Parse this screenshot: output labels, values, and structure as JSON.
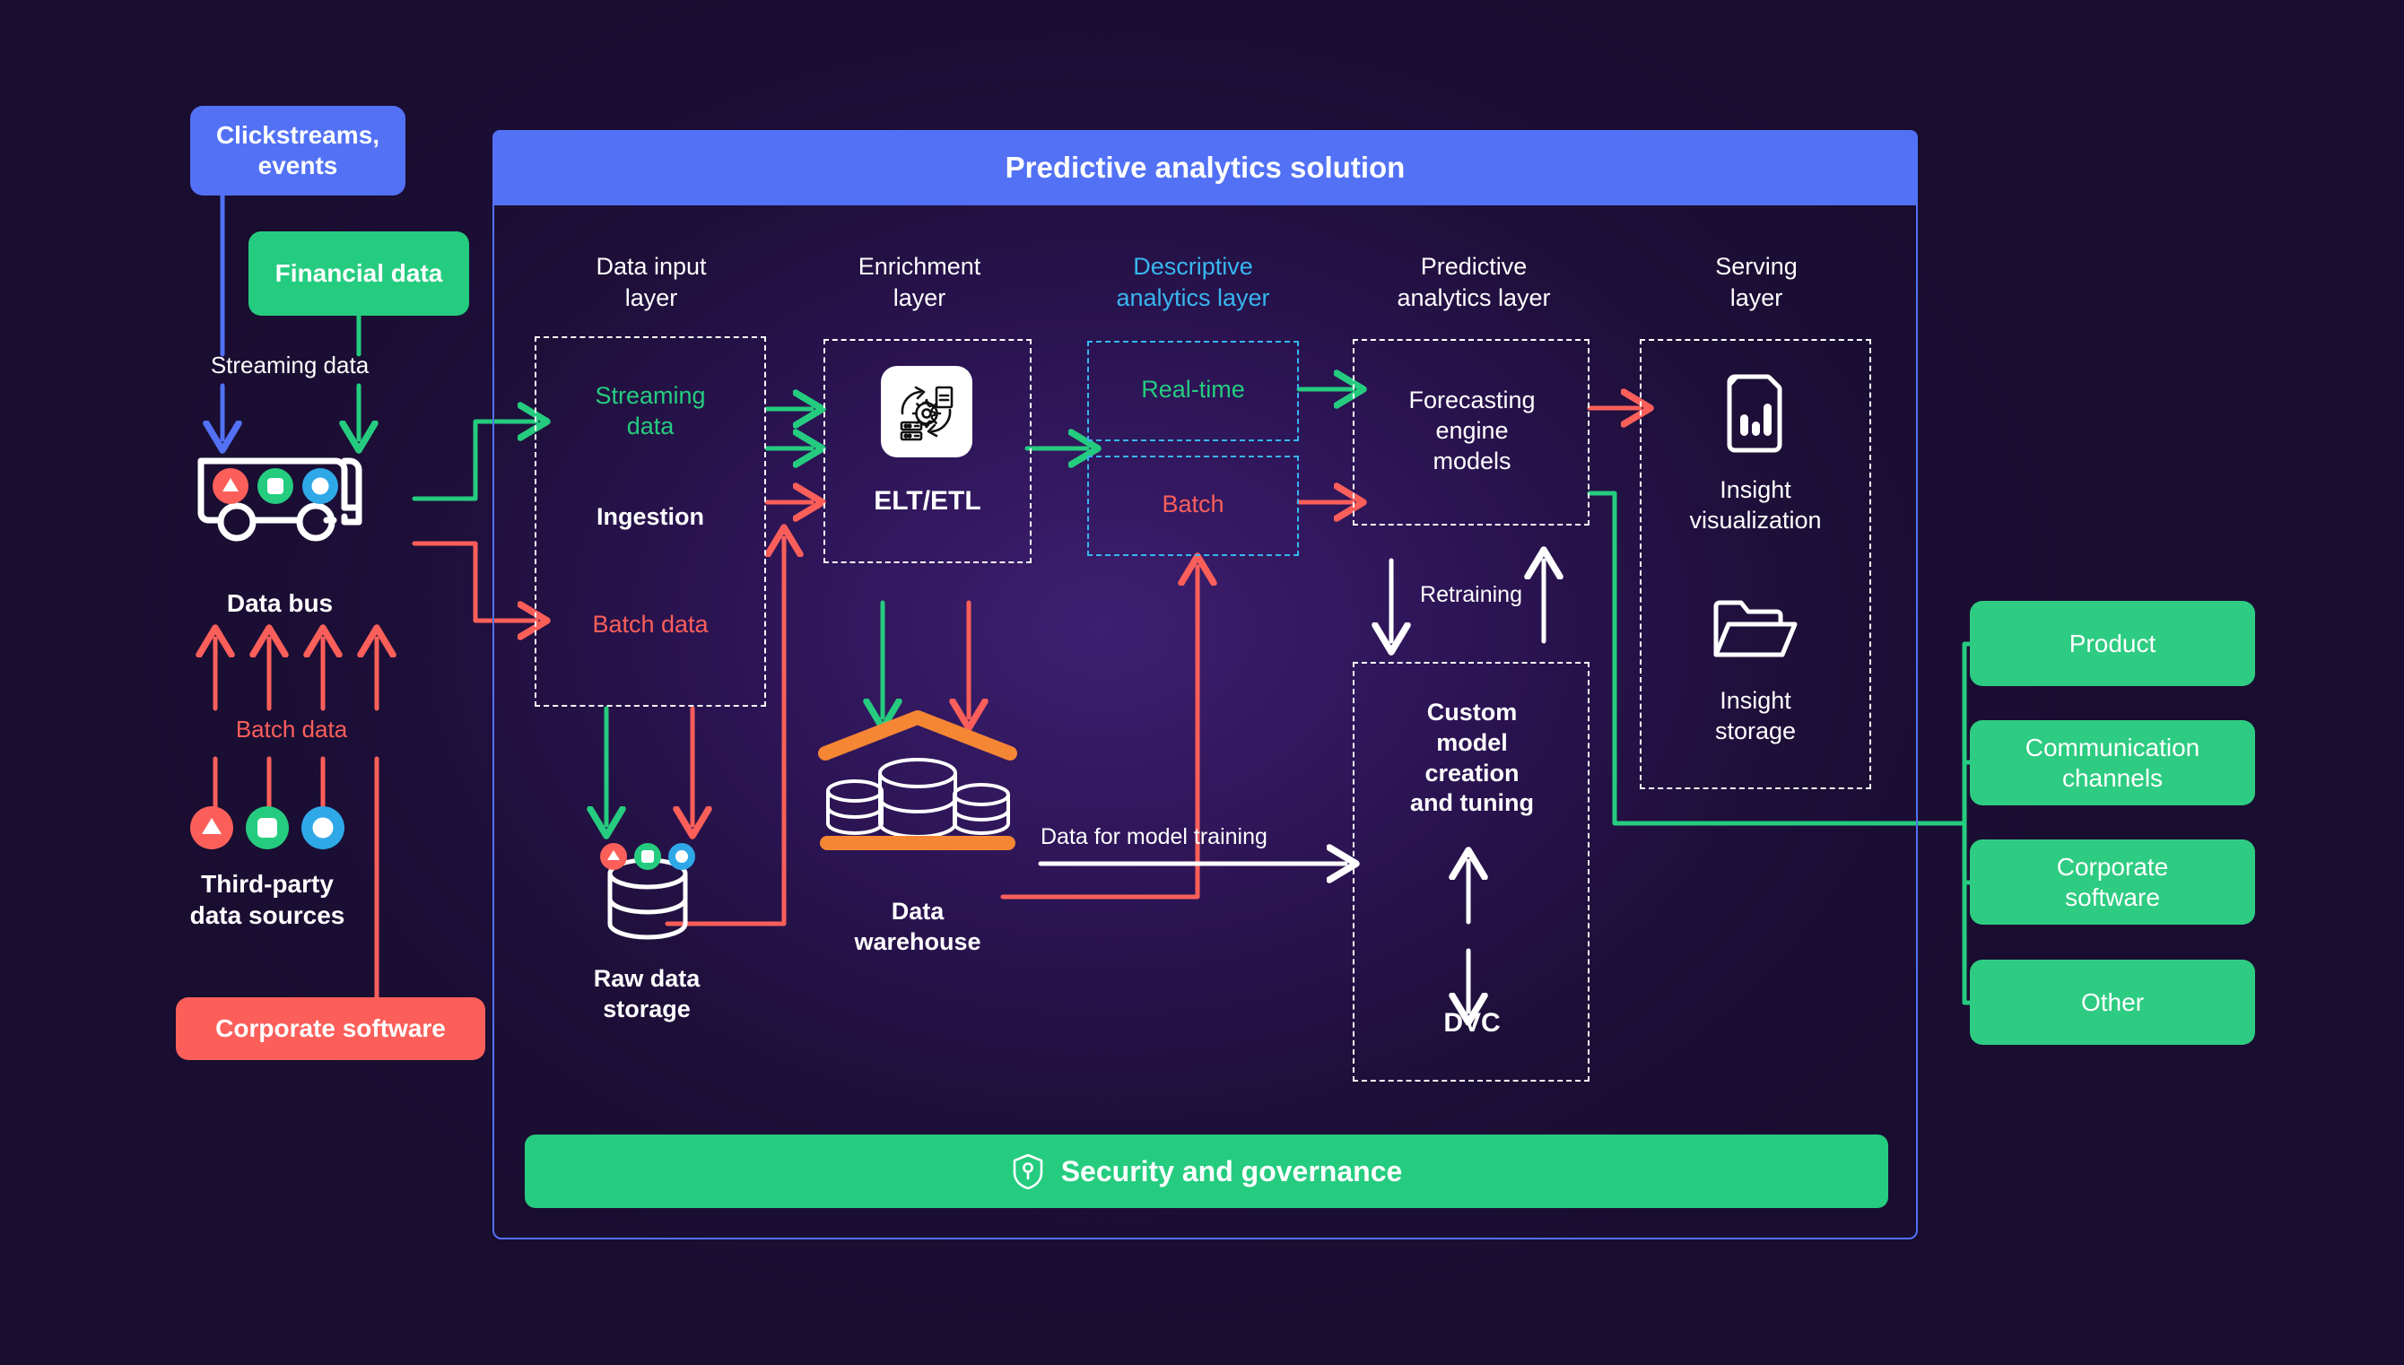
{
  "solution": {
    "title": "Predictive analytics solution"
  },
  "sources": {
    "clickstreams": "Clickstreams,\nevents",
    "financial": "Financial data",
    "streaming_label": "Streaming data",
    "data_bus": "Data bus",
    "batch_label": "Batch data",
    "third_party": "Third-party\ndata sources",
    "corporate_software": "Corporate software"
  },
  "layers": [
    {
      "key": "data_input",
      "title": "Data input\nlayer"
    },
    {
      "key": "enrichment",
      "title": "Enrichment\nlayer"
    },
    {
      "key": "descriptive",
      "title": "Descriptive\nanalytics layer"
    },
    {
      "key": "predictive",
      "title": "Predictive\nanalytics layer"
    },
    {
      "key": "serving",
      "title": "Serving\nlayer"
    }
  ],
  "data_input": {
    "streaming": "Streaming\ndata",
    "ingestion": "Ingestion",
    "batch": "Batch data"
  },
  "enrichment": {
    "label": "ELT/ETL",
    "icon": "etl-process-icon"
  },
  "descriptive": {
    "realtime": "Real-time",
    "batch": "Batch"
  },
  "predictive": {
    "forecasting": "Forecasting\nengine\nmodels",
    "retraining": "Retraining",
    "custom_model": "Custom\nmodel\ncreation\nand tuning",
    "dvc": "DVC"
  },
  "serving": {
    "visualization": "Insight\nvisualization",
    "visualization_icon": "document-chart-icon",
    "storage": "Insight\nstorage",
    "storage_icon": "folder-icon"
  },
  "storage": {
    "raw_data": "Raw data\nstorage",
    "raw_data_icon": "database-cylinder-icon",
    "warehouse": "Data\nwarehouse",
    "warehouse_icon": "data-warehouse-icon",
    "training_label": "Data for model training"
  },
  "consumers": [
    {
      "label": "Product"
    },
    {
      "label": "Communication\nchannels"
    },
    {
      "label": "Corporate\nsoftware"
    },
    {
      "label": "Other"
    }
  ],
  "security": {
    "label": "Security and governance",
    "icon": "shield-keyhole-icon"
  },
  "colors": {
    "background": "#190d30",
    "accent_blue": "#5271f5",
    "accent_green": "#25cc7f",
    "accent_red": "#fc5f5a",
    "accent_cyan": "#38b6f0",
    "accent_orange": "#f58634",
    "white": "#ffffff"
  }
}
